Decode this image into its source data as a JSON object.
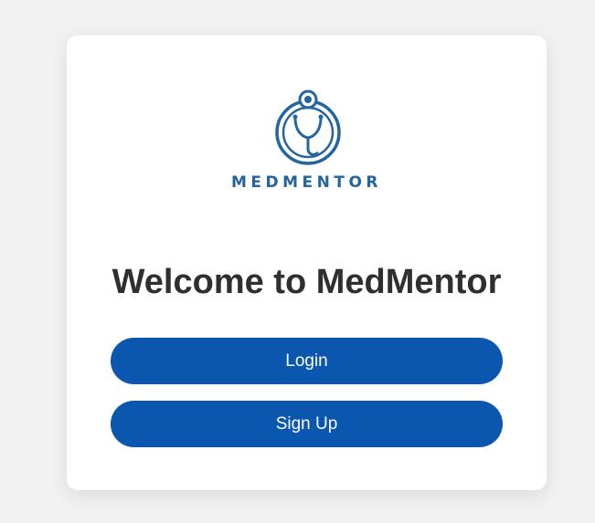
{
  "brand": {
    "name": "MEDMENTOR",
    "logo_icon": "stethoscope-icon",
    "color": "#24649f"
  },
  "welcome": {
    "title": "Welcome to MedMentor"
  },
  "actions": {
    "login_label": "Login",
    "signup_label": "Sign Up",
    "button_color": "#0b56ae"
  }
}
